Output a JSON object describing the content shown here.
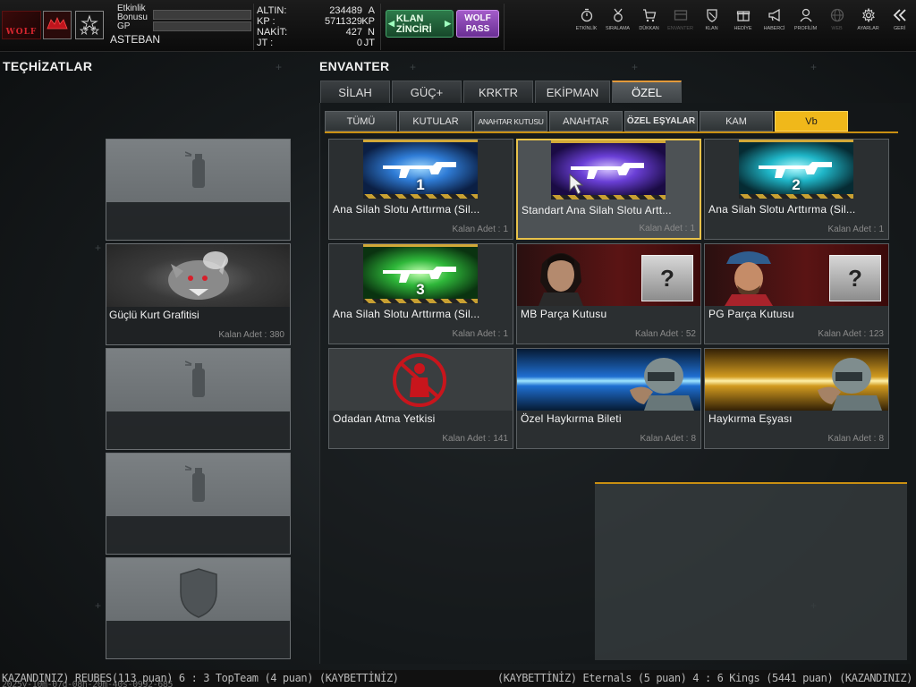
{
  "player": {
    "event_bonus_label": "Etkinlik Bonusu",
    "gp_label": "GP",
    "name": "ASTEBAN",
    "logo_text": "WOLF"
  },
  "currency": {
    "rows": [
      {
        "label": "ALTIN:",
        "value": "234489",
        "unit": "A"
      },
      {
        "label": "KP  :",
        "value": "5711329",
        "unit": "KP"
      },
      {
        "label": "NAKİT:",
        "value": "427",
        "unit": "N"
      },
      {
        "label": "JT  :",
        "value": "0",
        "unit": "JT"
      }
    ]
  },
  "buttons": {
    "clan_chain": "KLAN ZİNCİRİ",
    "wolf_pass": "WOLF PASS"
  },
  "topnav": [
    {
      "label": "ETKİNLİK",
      "icon": "stopwatch-icon",
      "dim": false
    },
    {
      "label": "SIRALAMA",
      "icon": "medal-icon",
      "dim": false
    },
    {
      "label": "DÜKKAN",
      "icon": "cart-icon",
      "dim": false
    },
    {
      "label": "ENVANTER",
      "icon": "inventory-icon",
      "dim": true
    },
    {
      "label": "KLAN",
      "icon": "clan-shield-icon",
      "dim": false
    },
    {
      "label": "HEDİYE",
      "icon": "gift-icon",
      "dim": false
    },
    {
      "label": "HABERCİ",
      "icon": "megaphone-icon",
      "dim": false
    },
    {
      "label": "PROFİLİM",
      "icon": "profile-icon",
      "dim": false
    },
    {
      "label": "WEB",
      "icon": "globe-icon",
      "dim": true
    },
    {
      "label": "AYARLAR",
      "icon": "gear-icon",
      "dim": false
    },
    {
      "label": "GERİ",
      "icon": "back-icon",
      "dim": false
    }
  ],
  "equipment": {
    "title": "TEÇHİZATLAR",
    "slots": [
      {
        "type": "spray-slot",
        "name": "",
        "qty": ""
      },
      {
        "type": "graffiti",
        "name": "Güçlü Kurt Grafitisi",
        "qty": "380"
      },
      {
        "type": "spray-slot",
        "name": "",
        "qty": ""
      },
      {
        "type": "spray-slot",
        "name": "",
        "qty": ""
      },
      {
        "type": "shield-slot",
        "name": "",
        "qty": ""
      }
    ]
  },
  "inventory": {
    "title": "ENVANTER",
    "main_tabs": [
      {
        "label": "SİLAH",
        "active": false
      },
      {
        "label": "GÜÇ+",
        "active": false
      },
      {
        "label": "KRKTR",
        "active": false
      },
      {
        "label": "EKİPMAN",
        "active": false
      },
      {
        "label": "ÖZEL",
        "active": true
      }
    ],
    "sub_tabs": [
      {
        "label": "TÜMÜ",
        "active": false
      },
      {
        "label": "KUTULAR",
        "active": false
      },
      {
        "label": "ANAHTAR KUTUSU",
        "active": false
      },
      {
        "label": "ANAHTAR",
        "active": false
      },
      {
        "label": "ÖZEL EŞYALAR",
        "active": false
      },
      {
        "label": "KAM",
        "active": false
      },
      {
        "label": "Vb",
        "active": true
      }
    ],
    "qty_label": "Kalan Adet :",
    "items": [
      {
        "name": "Ana Silah Slotu Arttırma (Sil...",
        "qty": "1",
        "art": "weapon-slot",
        "num": "1",
        "color": "#2f7cd6",
        "selected": false
      },
      {
        "name": "Standart Ana Silah Slotu Artt...",
        "qty": "1",
        "art": "weapon-slot",
        "num": "",
        "color": "#6a3fd6",
        "selected": true
      },
      {
        "name": "Ana Silah Slotu Arttırma (Sil...",
        "qty": "1",
        "art": "weapon-slot",
        "num": "2",
        "color": "#1fb6c8",
        "selected": false
      },
      {
        "name": "Ana Silah Slotu Arttırma (Sil...",
        "qty": "1",
        "art": "weapon-slot",
        "num": "3",
        "color": "#2fb83a",
        "selected": false
      },
      {
        "name": "MB Parça Kutusu",
        "qty": "52",
        "art": "portrait-box",
        "num": "",
        "color": "#5a1414",
        "selected": false
      },
      {
        "name": "PG Parça Kutusu",
        "qty": "123",
        "art": "portrait-box",
        "num": "",
        "color": "#5a1414",
        "selected": false
      },
      {
        "name": "Odadan Atma Yetkisi",
        "qty": "141",
        "art": "kick-icon",
        "num": "",
        "color": "#c8151c",
        "selected": false
      },
      {
        "name": "Özel Haykırma Bileti",
        "qty": "8",
        "art": "shout-ticket",
        "num": "",
        "color": "#2b8ae6",
        "selected": false
      },
      {
        "name": "Haykırma Eşyası",
        "qty": "8",
        "art": "shout-item",
        "num": "",
        "color": "#e6b22b",
        "selected": false
      }
    ]
  },
  "ticker": {
    "left": "KAZANDINIZ) REUBES(113 puan) 6 : 3 TopTeam (4 puan) (KAYBETTİNİZ)",
    "right": "(KAYBETTİNİZ) Eternals (5 puan) 4 : 6 Kings (5441 puan) (KAZANDINIZ)",
    "timestamp": "2025y-10m-07d-08h-20m-40s-0992-685"
  }
}
